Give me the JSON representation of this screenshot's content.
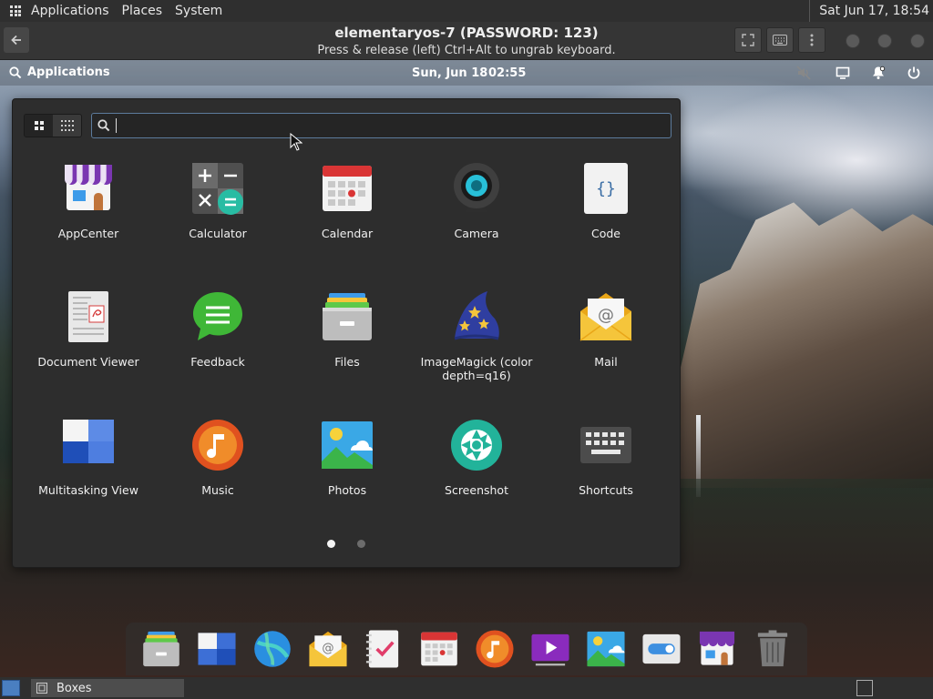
{
  "host_panel": {
    "menus": [
      "Applications",
      "Places",
      "System"
    ],
    "clock": "Sat Jun 17, 18:54"
  },
  "boxes": {
    "title": "elementaryos-7 (PASSWORD: 123)",
    "subtitle": "Press & release (left) Ctrl+Alt to ungrab keyboard."
  },
  "guest_panel": {
    "applications_label": "Applications",
    "date": "Sun, Jun 18",
    "time": "02:55"
  },
  "app_menu": {
    "search_value": "",
    "apps": [
      {
        "label": "AppCenter",
        "icon": "appcenter-icon"
      },
      {
        "label": "Calculator",
        "icon": "calculator-icon"
      },
      {
        "label": "Calendar",
        "icon": "calendar-icon"
      },
      {
        "label": "Camera",
        "icon": "camera-icon"
      },
      {
        "label": "Code",
        "icon": "code-icon"
      },
      {
        "label": "Document Viewer",
        "icon": "document-viewer-icon"
      },
      {
        "label": "Feedback",
        "icon": "feedback-icon"
      },
      {
        "label": "Files",
        "icon": "files-icon"
      },
      {
        "label": "ImageMagick (color depth=q16)",
        "icon": "imagemagick-icon"
      },
      {
        "label": "Mail",
        "icon": "mail-icon"
      },
      {
        "label": "Multitasking View",
        "icon": "multitasking-icon"
      },
      {
        "label": "Music",
        "icon": "music-icon"
      },
      {
        "label": "Photos",
        "icon": "photos-icon"
      },
      {
        "label": "Screenshot",
        "icon": "screenshot-icon"
      },
      {
        "label": "Shortcuts",
        "icon": "shortcuts-icon"
      }
    ],
    "pages": 2,
    "current_page": 1
  },
  "dock_items": [
    "files-icon",
    "multitasking-icon",
    "web-browser-icon",
    "mail-icon",
    "tasks-icon",
    "calendar-icon",
    "music-icon",
    "videos-icon",
    "photos-icon",
    "settings-icon",
    "appcenter-icon",
    "trash-icon"
  ],
  "host_taskbar": {
    "task_label": "Boxes"
  },
  "colors": {
    "menu_bg": "#2d2d2d",
    "search_border": "#5c7b9c",
    "host_panel": "#2f2f2f"
  }
}
